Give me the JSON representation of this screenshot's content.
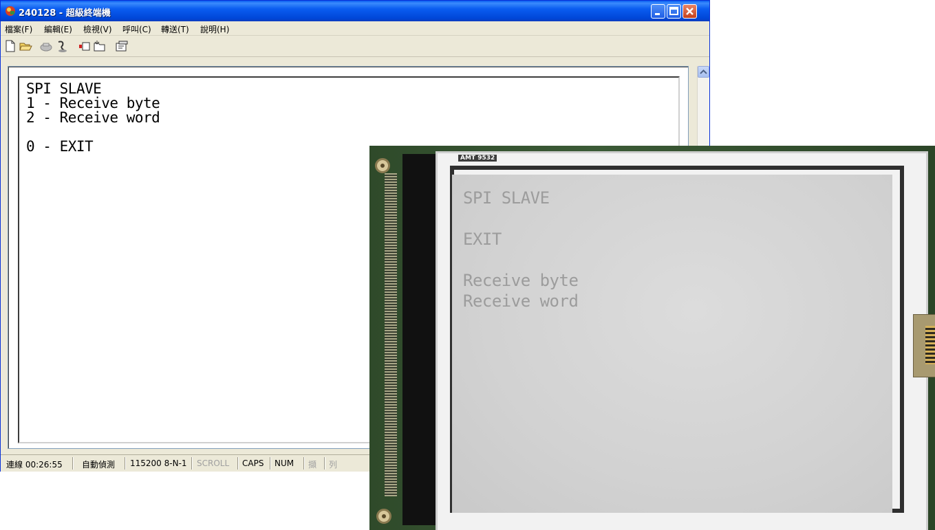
{
  "window": {
    "title": "240128 - 超級終端機",
    "app_icon": "hyperterminal-icon",
    "controls": [
      "minimize-icon",
      "maximize-icon",
      "close-icon"
    ]
  },
  "menu": [
    {
      "label": "檔案(F)"
    },
    {
      "label": "編輯(E)"
    },
    {
      "label": "檢視(V)"
    },
    {
      "label": "呼叫(C)"
    },
    {
      "label": "轉送(T)"
    },
    {
      "label": "說明(H)"
    }
  ],
  "toolbar": [
    "new-icon",
    "open-icon",
    "connect-icon",
    "disconnect-icon",
    "send-icon",
    "receive-icon",
    "properties-icon"
  ],
  "terminal": {
    "lines": [
      "SPI SLAVE",
      "1 - Receive byte",
      "2 - Receive word",
      "",
      "0 - EXIT"
    ]
  },
  "status": {
    "connected": "連線 00:26:55",
    "detect": "自動偵測",
    "port": "115200 8-N-1",
    "scroll": "SCROLL",
    "caps": "CAPS",
    "num": "NUM",
    "capture": "擷",
    "print": "列"
  },
  "lcd_photo": {
    "board_label": "AMT 9532",
    "lines": [
      "SPI SLAVE",
      "EXIT",
      "Receive byte",
      "Receive word"
    ]
  },
  "colors": {
    "titlebar": "#0a5cf0",
    "lcd_background": "#d2d2d2",
    "lcd_text": "#9c9c9c",
    "pcb": "#3b5a36"
  }
}
